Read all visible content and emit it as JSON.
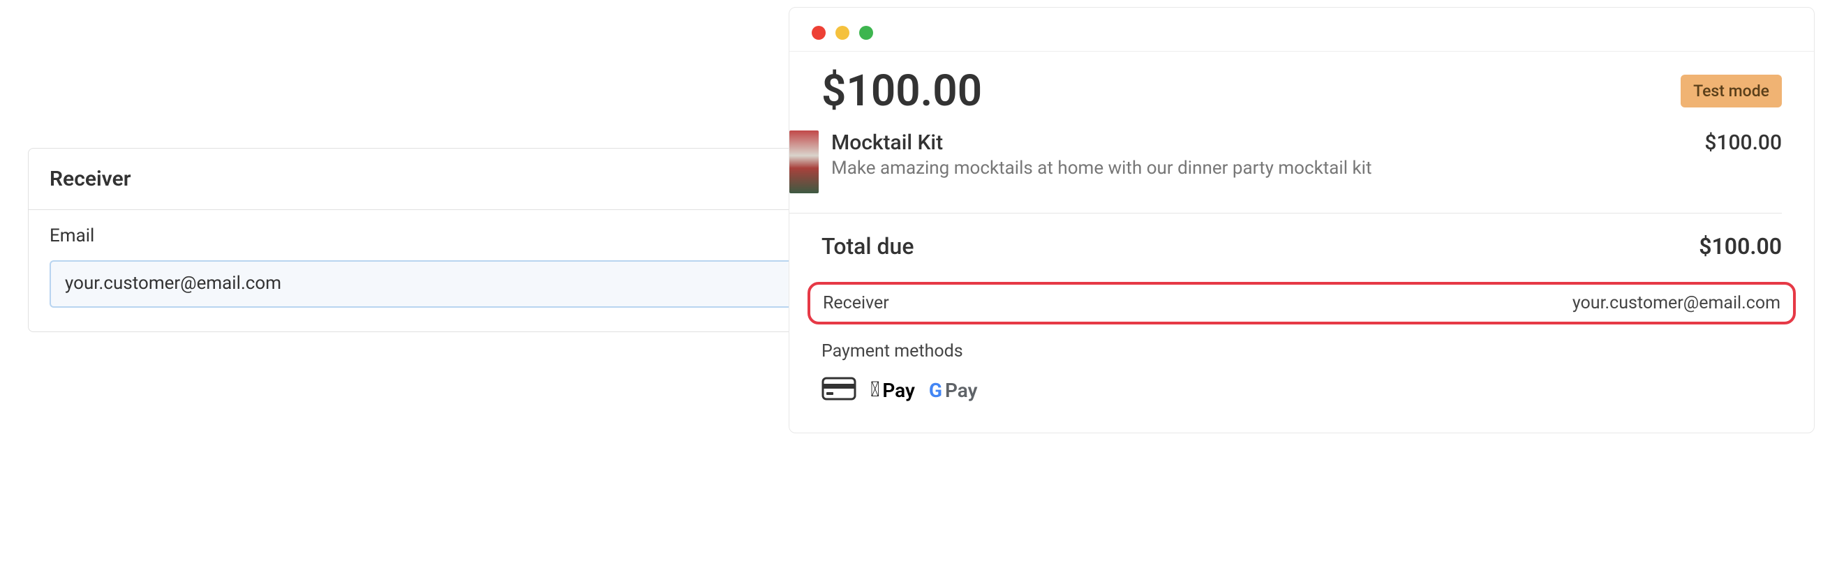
{
  "left": {
    "title": "Receiver",
    "emailLabel": "Email",
    "emailValue": "your.customer@email.com"
  },
  "checkout": {
    "mainPrice": "$100.00",
    "badge": "Test mode",
    "item": {
      "name": "Mocktail Kit",
      "description": "Make amazing mocktails at home with our dinner party mocktail kit",
      "price": "$100.00"
    },
    "totalLabel": "Total due",
    "totalAmount": "$100.00",
    "receiverLabel": "Receiver",
    "receiverValue": "your.customer@email.com",
    "paymentMethodsLabel": "Payment methods",
    "applePayText": "Pay",
    "googlePayText": "Pay"
  }
}
